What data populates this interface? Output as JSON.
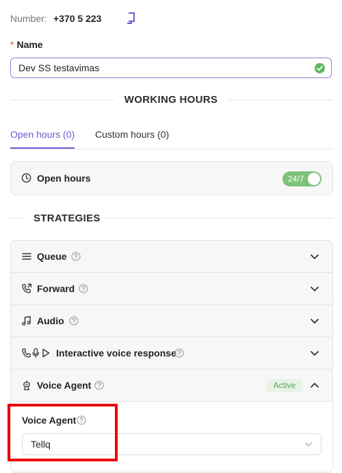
{
  "number": {
    "label": "Number:",
    "value": "+370 5 223"
  },
  "name_field": {
    "required_mark": "*",
    "label": "Name",
    "value": "Dev SS testavimas"
  },
  "working_hours": {
    "title": "WORKING HOURS",
    "tabs": [
      {
        "label": "Open hours (0)",
        "active": true
      },
      {
        "label": "Custom hours (0)",
        "active": false
      }
    ],
    "open_hours": {
      "label": "Open hours",
      "toggle_label": "24/7",
      "toggle_on": true
    }
  },
  "strategies": {
    "title": "STRATEGIES",
    "items": [
      {
        "label": "Queue",
        "icon": "list-icon",
        "expanded": false
      },
      {
        "label": "Forward",
        "icon": "phone-forward-icon",
        "expanded": false
      },
      {
        "label": "Audio",
        "icon": "music-note-icon",
        "expanded": false
      },
      {
        "label": "Interactive voice response",
        "icon": "phone-mic-play-icon",
        "expanded": false
      },
      {
        "label": "Voice Agent",
        "icon": "robot-icon",
        "expanded": true,
        "badge": "Active"
      }
    ],
    "voice_agent_panel": {
      "label": "Voice Agent",
      "select_value": "Tellq"
    }
  },
  "colors": {
    "accent": "#6d5bd0",
    "toggle_on": "#7cc27a",
    "active_badge_text": "#58a55a",
    "active_badge_bg": "#e8f3e6",
    "highlight_box": "#ea0000"
  }
}
